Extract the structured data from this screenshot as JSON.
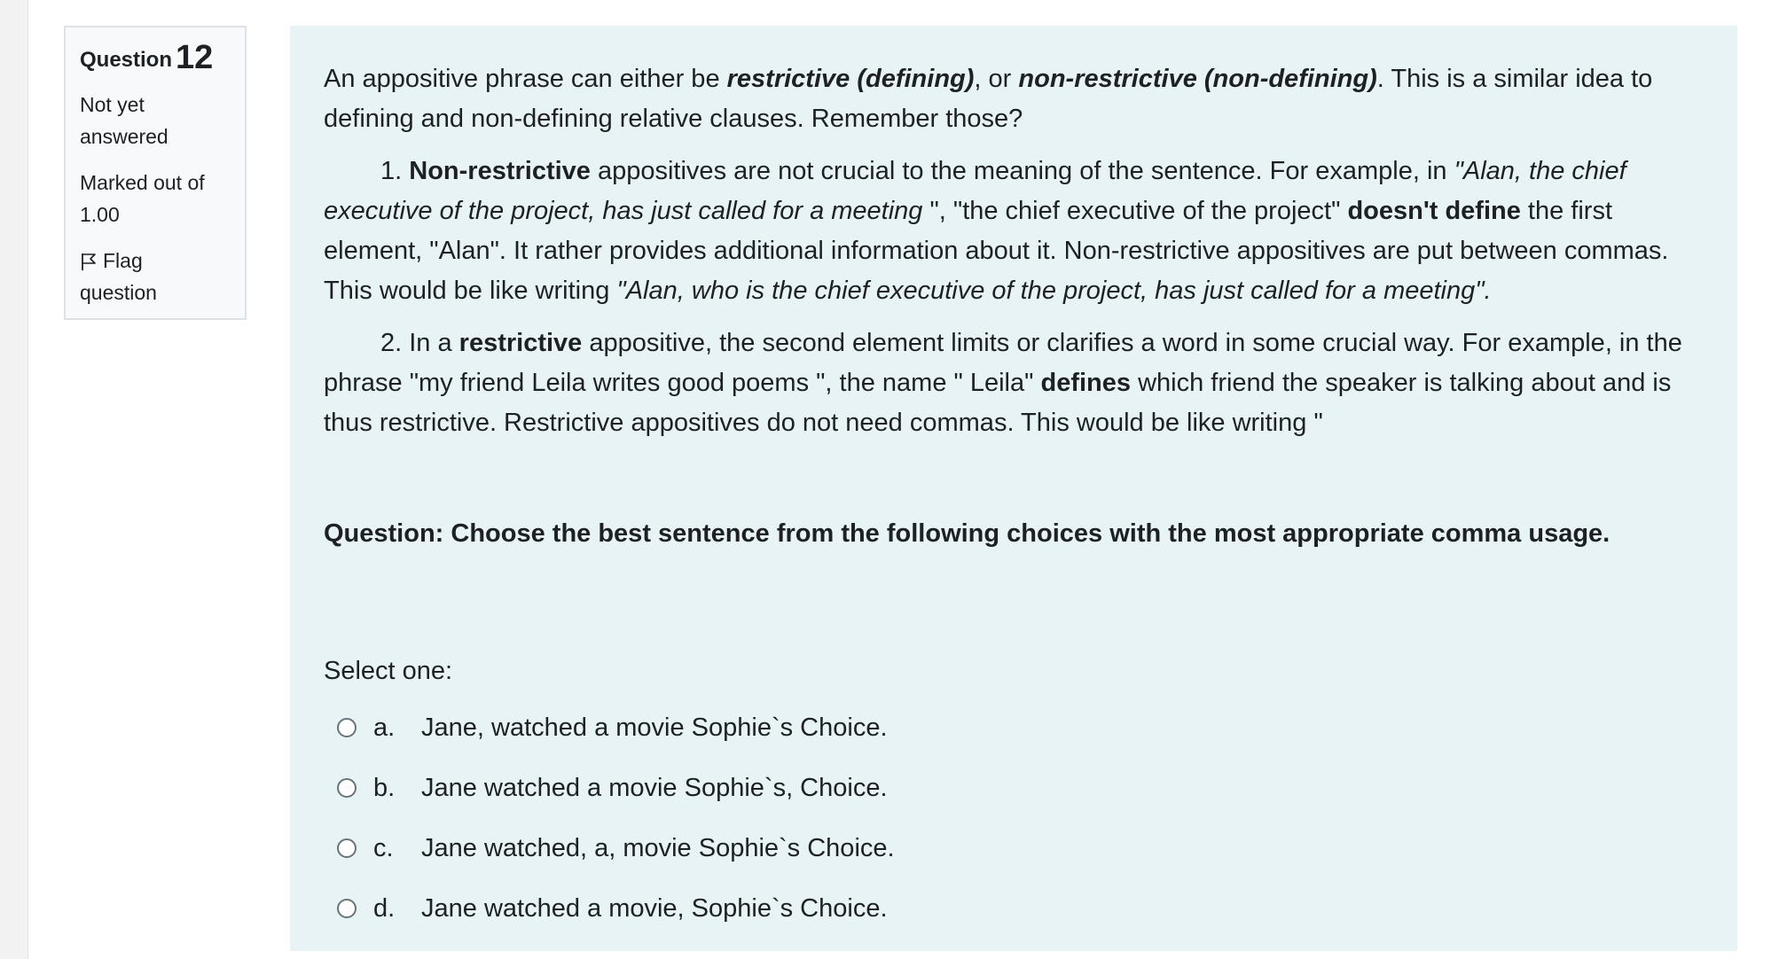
{
  "question_info": {
    "label": "Question",
    "number": "12",
    "status_line1": "Not yet",
    "status_line2": "answered",
    "marked_line1": "Marked out of",
    "marked_line2": "1.00",
    "flag_line1": "Flag",
    "flag_line2": "question"
  },
  "content": {
    "intro": {
      "t1": "An appositive phrase can either be ",
      "b1": "restrictive (defining)",
      "t2": ", or ",
      "b2": "non-restrictive (non-defining)",
      "t3": ". This is a similar idea to defining and non-defining relative clauses. Remember those?"
    },
    "point1": {
      "t1": "1. ",
      "b1": "Non-restrictive",
      "t2": " appositives are not crucial to the meaning of the sentence. For example, in ",
      "i1": "\"Alan, the chief executive of the project, has just called for a meeting ",
      "t3": "\", \"the chief executive of the project\" ",
      "b2": "doesn't define",
      "t4": " the first element, \"Alan\". It rather provides additional information about it. Non-restrictive appositives are put between commas. This would be like writing ",
      "i2": "\"Alan, who is the chief executive of the project, has just called for a meeting\"."
    },
    "point2": {
      "t1": "2. In a ",
      "b1": "restrictive",
      "t2": " appositive, the second element limits or clarifies a word in some crucial way. For example, in the phrase \"my friend Leila writes good poems \", the name \" Leila\" ",
      "b2": "defines",
      "t3": " which friend the speaker is talking about and is thus restrictive. Restrictive appositives do not need commas. This would be like writing \""
    },
    "question": "Question: Choose the best sentence from the following choices with the most appropriate comma usage."
  },
  "answer_block": {
    "prompt": "Select one:",
    "options": [
      {
        "letter": "a.",
        "text": "Jane, watched a movie Sophie`s Choice."
      },
      {
        "letter": "b.",
        "text": "Jane watched a movie Sophie`s, Choice."
      },
      {
        "letter": "c.",
        "text": "Jane watched, a, movie Sophie`s Choice."
      },
      {
        "letter": "d.",
        "text": "Jane watched a movie, Sophie`s Choice."
      }
    ]
  },
  "icons": {
    "flag": "flag-icon",
    "radio": "radio-icon"
  },
  "colors": {
    "content_bg": "#e7f3f5",
    "info_bg": "#f8f9fa",
    "text": "#1d2125",
    "border": "#dee2e6"
  }
}
